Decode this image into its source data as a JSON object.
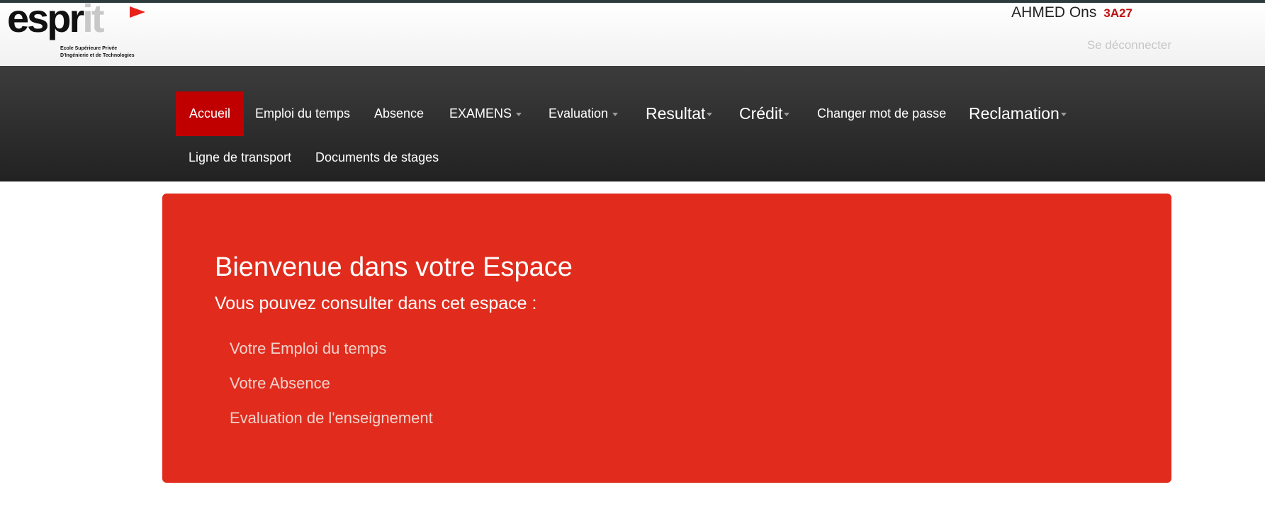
{
  "header": {
    "logo": {
      "word_main": "espr",
      "word_accent": "it",
      "tagline_line1": "Ecole Supérieure Privée",
      "tagline_line2": "D'Ingénierie et de Technologies"
    },
    "user": {
      "name": "AHMED Ons",
      "class": "3A27"
    },
    "logout_label": "Se déconnecter"
  },
  "nav": {
    "accueil": "Accueil",
    "emploi": "Emploi du temps",
    "absence": "Absence",
    "examens": "EXAMENS",
    "evaluation": "Evaluation",
    "resultat": "Resultat",
    "credit": "Crédit",
    "changer_mdp": "Changer mot de passe",
    "reclamation": "Reclamation",
    "transport": "Ligne de transport",
    "stages": "Documents de stages"
  },
  "main": {
    "title": "Bienvenue dans votre Espace",
    "subtitle": "Vous pouvez consulter dans cet espace :",
    "links": [
      "Votre Emploi du temps",
      "Votre Absence",
      "Evaluation de l'enseignement"
    ]
  },
  "colors": {
    "brand_red": "#e12c1d",
    "active_nav": "#c00000",
    "nav_bg": "#2b2b2b"
  }
}
